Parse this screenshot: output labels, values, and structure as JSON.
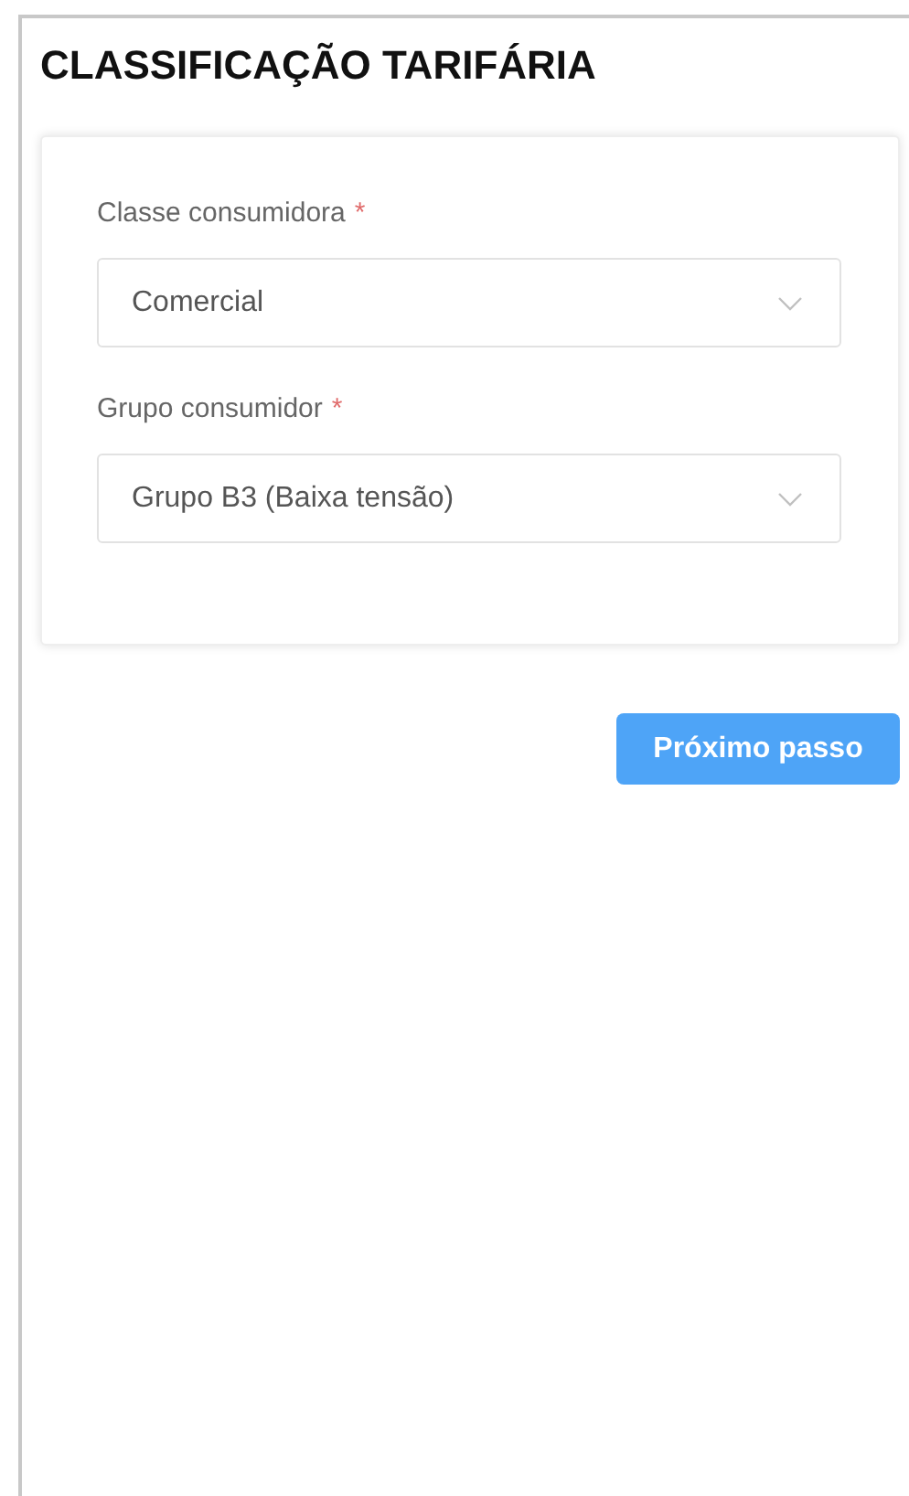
{
  "title": "CLASSIFICAÇÃO TARIFÁRIA",
  "fields": [
    {
      "label": "Classe consumidora",
      "required_mark": "*",
      "value": "Comercial"
    },
    {
      "label": "Grupo consumidor",
      "required_mark": "*",
      "value": "Grupo B3 (Baixa tensão)"
    }
  ],
  "next_button": "Próximo passo"
}
